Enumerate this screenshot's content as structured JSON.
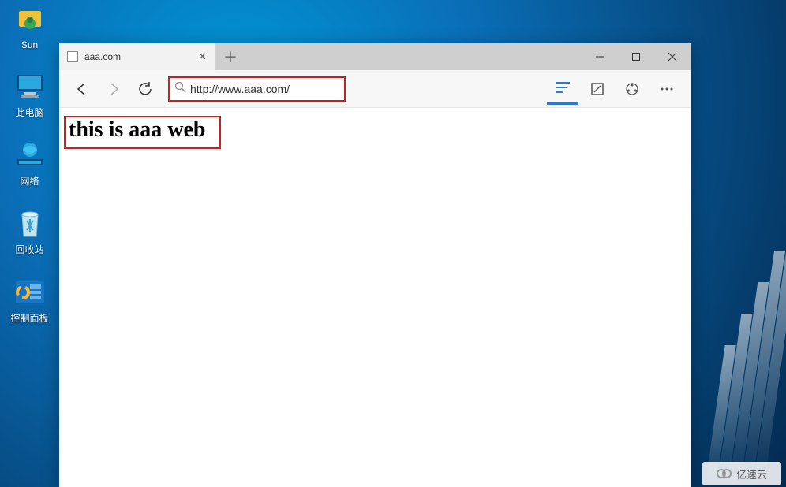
{
  "desktop": {
    "icons": [
      {
        "name": "user-icon",
        "label": "Sun"
      },
      {
        "name": "this-pc-icon",
        "label": "此电脑"
      },
      {
        "name": "network-icon",
        "label": "网络"
      },
      {
        "name": "recycle-bin-icon",
        "label": "回收站"
      },
      {
        "name": "control-panel-icon",
        "label": "控制面板"
      }
    ]
  },
  "browser": {
    "tab": {
      "title": "aaa.com"
    },
    "address_url": "http://www.aaa.com/",
    "page": {
      "heading": "this is aaa web"
    }
  },
  "watermark": {
    "text": "亿速云"
  }
}
